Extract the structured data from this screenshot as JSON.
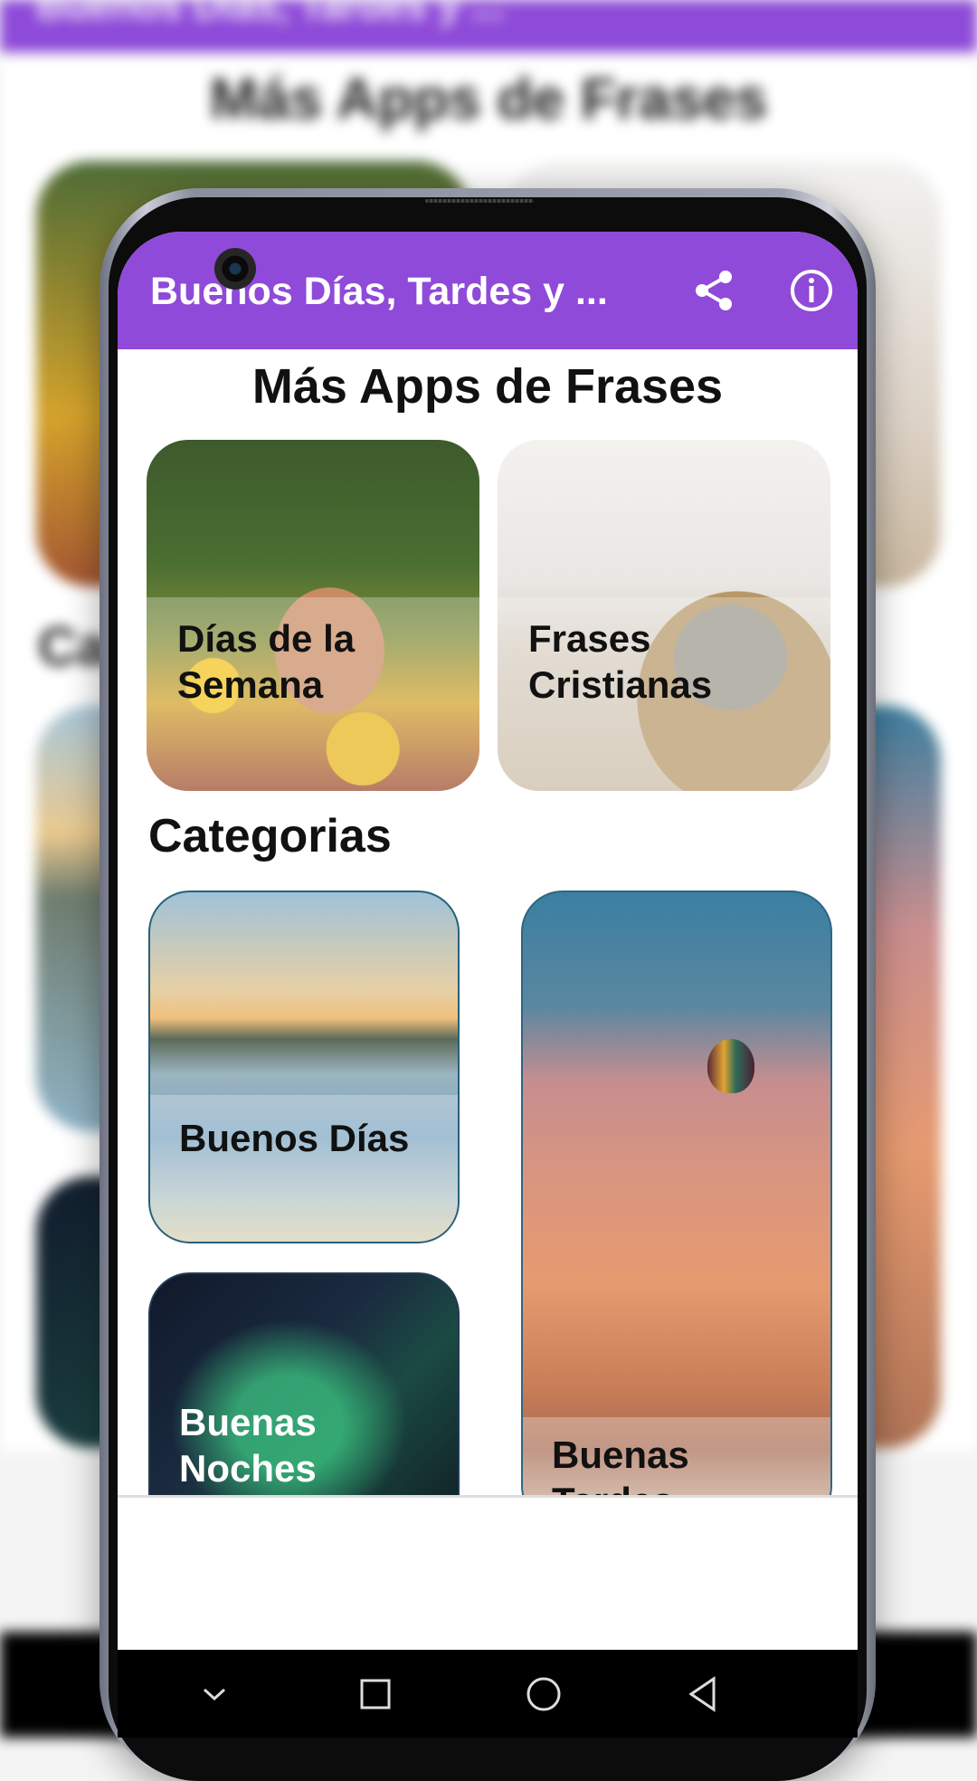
{
  "background": {
    "app_title": "Buenos Días, Tardes y ...",
    "section_title": "Más Apps de Frases",
    "partial_category_title": "Ca"
  },
  "app_bar": {
    "title": "Buenos Días, Tardes y ...",
    "color": "#8f4ad9",
    "actions": [
      "share-icon",
      "info-icon"
    ]
  },
  "more_apps": {
    "title": "Más Apps de Frases",
    "items": [
      {
        "label": "Días de la\nSemana",
        "line1": "Días de la",
        "line2": "Semana"
      },
      {
        "label": "Frases\nCristianas",
        "line1": "Frases",
        "line2": "Cristianas"
      }
    ]
  },
  "categories": {
    "title": "Categorias",
    "items": [
      {
        "line1": "Buenos Días",
        "line2": ""
      },
      {
        "line1": "Buenas",
        "line2": "Noches"
      },
      {
        "line1": "Buenas",
        "line2": "Tardes"
      }
    ]
  },
  "navbar": {
    "buttons": [
      "chevron-down-icon",
      "square-icon",
      "circle-icon",
      "back-triangle-icon"
    ]
  }
}
